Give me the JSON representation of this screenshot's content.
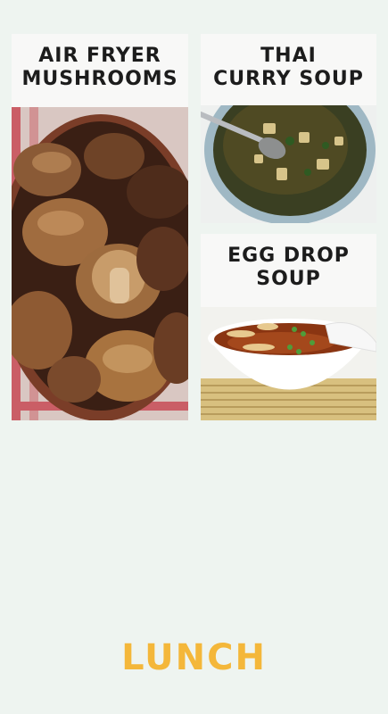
{
  "cards": [
    {
      "title_line1": "AIR FRYER",
      "title_line2": "MUSHROOMS",
      "image": "air-fryer-mushrooms-photo"
    },
    {
      "title_line1": "THAI",
      "title_line2": "CURRY SOUP",
      "image": "thai-curry-soup-photo"
    },
    {
      "title_line1": "EGG DROP",
      "title_line2": "SOUP",
      "image": "egg-drop-soup-photo"
    }
  ],
  "footer": {
    "label": "LUNCH"
  },
  "colors": {
    "background": "#eef4f0",
    "accent": "#f4b73a",
    "title_text": "#1c1c1c"
  }
}
